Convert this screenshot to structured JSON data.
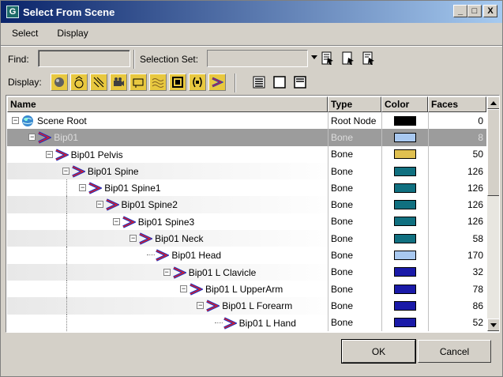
{
  "window": {
    "title": "Select From Scene",
    "app_icon_letter": "G",
    "minimize_label": "_",
    "maximize_label": "□",
    "close_label": "X"
  },
  "menu": {
    "items": [
      "Select",
      "Display"
    ]
  },
  "find": {
    "label": "Find:",
    "value": ""
  },
  "selection_set": {
    "label": "Selection Set:",
    "value": ""
  },
  "display": {
    "label": "Display:"
  },
  "table": {
    "columns": [
      "Name",
      "Type",
      "Color",
      "Faces"
    ],
    "rows": [
      {
        "name": "Scene Root",
        "type": "Root Node",
        "color": "#000000",
        "faces": "0"
      },
      {
        "name": "Bip01",
        "type": "Bone",
        "color": "#a8c8f0",
        "faces": "8",
        "selected": true
      },
      {
        "name": "Bip01 Pelvis",
        "type": "Bone",
        "color": "#e0c050",
        "faces": "50"
      },
      {
        "name": "Bip01 Spine",
        "type": "Bone",
        "color": "#107080",
        "faces": "126"
      },
      {
        "name": "Bip01 Spine1",
        "type": "Bone",
        "color": "#107080",
        "faces": "126"
      },
      {
        "name": "Bip01 Spine2",
        "type": "Bone",
        "color": "#107080",
        "faces": "126"
      },
      {
        "name": "Bip01 Spine3",
        "type": "Bone",
        "color": "#107080",
        "faces": "126"
      },
      {
        "name": "Bip01 Neck",
        "type": "Bone",
        "color": "#107080",
        "faces": "58"
      },
      {
        "name": "Bip01 Head",
        "type": "Bone",
        "color": "#a8c8f0",
        "faces": "170"
      },
      {
        "name": "Bip01 L Clavicle",
        "type": "Bone",
        "color": "#1a1aa8",
        "faces": "32"
      },
      {
        "name": "Bip01 L UpperArm",
        "type": "Bone",
        "color": "#1a1aa8",
        "faces": "78"
      },
      {
        "name": "Bip01 L Forearm",
        "type": "Bone",
        "color": "#1a1aa8",
        "faces": "86"
      },
      {
        "name": "Bip01 L Hand",
        "type": "Bone",
        "color": "#1a1aa8",
        "faces": "52"
      }
    ]
  },
  "buttons": {
    "ok": "OK",
    "cancel": "Cancel"
  }
}
